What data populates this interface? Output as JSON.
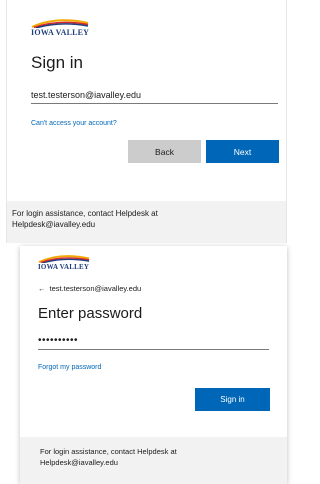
{
  "brand": {
    "logo_text": "IOWA VALLEY",
    "swoosh_colors": [
      "#f2a900",
      "#d7262e",
      "#1f3e7c"
    ]
  },
  "signin": {
    "title": "Sign in",
    "email_value": "test.testerson@iavalley.edu",
    "cant_access_link": "Can't access your account?",
    "back_label": "Back",
    "next_label": "Next",
    "footer_line1": "For login assistance, contact Helpdesk at",
    "footer_line2": "Helpdesk@iavalley.edu"
  },
  "password": {
    "back_arrow": "←",
    "identity_email": "test.testerson@iavalley.edu",
    "title": "Enter password",
    "password_value": "••••••••••",
    "forgot_link": "Forgot my password",
    "signin_label": "Sign in",
    "footer_line1": "For login assistance, contact Helpdesk at",
    "footer_line2": "Helpdesk@iavalley.edu"
  },
  "colors": {
    "accent": "#0067b8",
    "secondary_button": "#cccccc",
    "footer_bg": "#f2f2f2"
  }
}
